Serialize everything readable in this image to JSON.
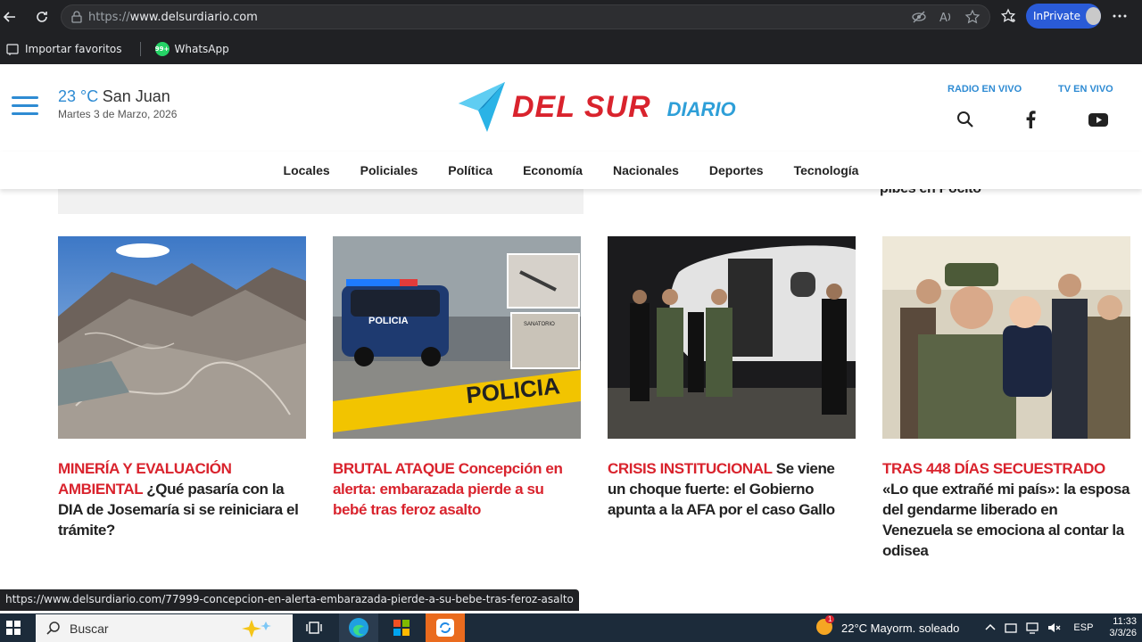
{
  "browser": {
    "url_protocol": "https://",
    "url_host": "www.delsurdiario.com",
    "inprivate_label": "InPrivate",
    "favorites": [
      {
        "label": "Importar favoritos"
      },
      {
        "label": "WhatsApp",
        "badge": "99+"
      }
    ]
  },
  "site": {
    "weather": {
      "temp": "23 °C",
      "city": "San Juan",
      "date": "Martes 3 de Marzo, 2026"
    },
    "logo": {
      "primary": "DEL SUR",
      "secondary": "DIARIO"
    },
    "live": {
      "radio": "RADIO EN VIVO",
      "tv": "TV EN VIVO"
    },
    "nav": [
      "Locales",
      "Policiales",
      "Política",
      "Economía",
      "Nacionales",
      "Deportes",
      "Tecnología"
    ],
    "prev_headline_fragment": "pibes en Pocito",
    "colors": {
      "accent_red": "#d9232d",
      "accent_blue": "#2e8bd3"
    }
  },
  "articles": [
    {
      "kicker": "MINERÍA Y EVALUACIÓN AMBIENTAL",
      "title": "¿Qué pasaría con la DIA de Josemaría si se reiniciara el trámite?",
      "title_red": false
    },
    {
      "kicker": "BRUTAL ATAQUE",
      "title": "Concepción en alerta: embarazada pierde a su bebé tras feroz asalto",
      "title_red": true
    },
    {
      "kicker": "CRISIS INSTITUCIONAL",
      "title": "Se viene un choque fuerte: el Gobierno apunta a la AFA por el caso Gallo",
      "title_red": false
    },
    {
      "kicker": "TRAS 448 DÍAS SECUESTRADO",
      "title": "«Lo que extrañé mi país»: la esposa del gendarme liberado en Venezuela se emociona al contar la odisea",
      "title_red": false
    }
  ],
  "image_overlay": {
    "police_car": "POLICIA",
    "tape": "POLICIA",
    "sign": "SANATORIO"
  },
  "status_url": "https://www.delsurdiario.com/77999-concepcion-en-alerta-embarazada-pierde-a-su-bebe-tras-feroz-asalto",
  "taskbar": {
    "search_placeholder": "Buscar",
    "weather": "22°C  Mayorm. soleado",
    "weather_badge": "1",
    "lang": "ESP",
    "time": "11:33",
    "date": "3/3/26"
  }
}
